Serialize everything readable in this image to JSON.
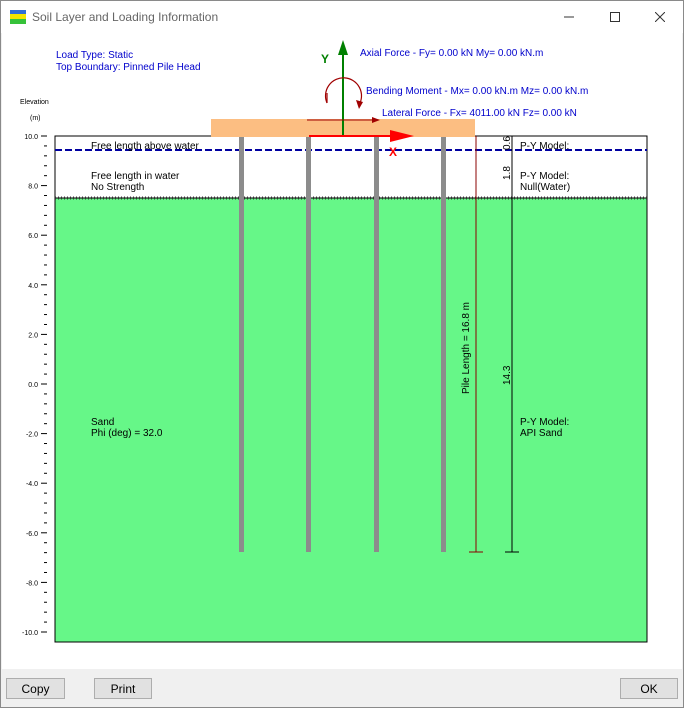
{
  "window": {
    "title": "Soil Layer and Loading Information"
  },
  "info": {
    "load_type": "Load Type: Static",
    "top_boundary": "Top Boundary: Pinned Pile Head"
  },
  "forces": {
    "axial": "Axial Force - Fy= 0.00 kN My= 0.00 kN.m",
    "bending": "Bending Moment - Mx= 0.00 kN.m Mz= 0.00 kN.m",
    "lateral": "Lateral Force - Fx= 4011.00 kN Fz= 0.00 kN",
    "y_axis_label": "Y",
    "x_axis_label": "X"
  },
  "elevation_axis": {
    "title": "Elevation",
    "unit": "(m)",
    "ticks": [
      "10.0",
      "8.0",
      "6.0",
      "4.0",
      "2.0",
      "0.0",
      "-2.0",
      "-4.0",
      "-6.0",
      "-8.0",
      "-10.0"
    ]
  },
  "layers": {
    "free_above_water": "Free length above water",
    "free_in_water_line1": "Free length in water",
    "free_in_water_line2": "No Strength",
    "sand_line1": "Sand",
    "sand_line2": "Phi (deg) =   32.0"
  },
  "dimensions": {
    "d1": "0.6",
    "d2": "1.8",
    "d3": "14.3",
    "pile_length": "Pile Length = 16.8 m"
  },
  "py_models": {
    "m1": "P-Y Model:",
    "m2_line1": "P-Y Model:",
    "m2_line2": "Null(Water)",
    "m3_line1": "P-Y Model:",
    "m3_line2": "API Sand"
  },
  "buttons": {
    "copy": "Copy",
    "print": "Print",
    "ok": "OK"
  },
  "colors": {
    "sand": "#66f788",
    "pile_cap": "#fcbe82",
    "pile": "#8c8c8c",
    "water_line": "#0000a0",
    "axial_arrow": "#008000",
    "lateral_arrow": "#ff0000",
    "moment_arrow": "#a00000",
    "info_text": "#0000cc"
  }
}
